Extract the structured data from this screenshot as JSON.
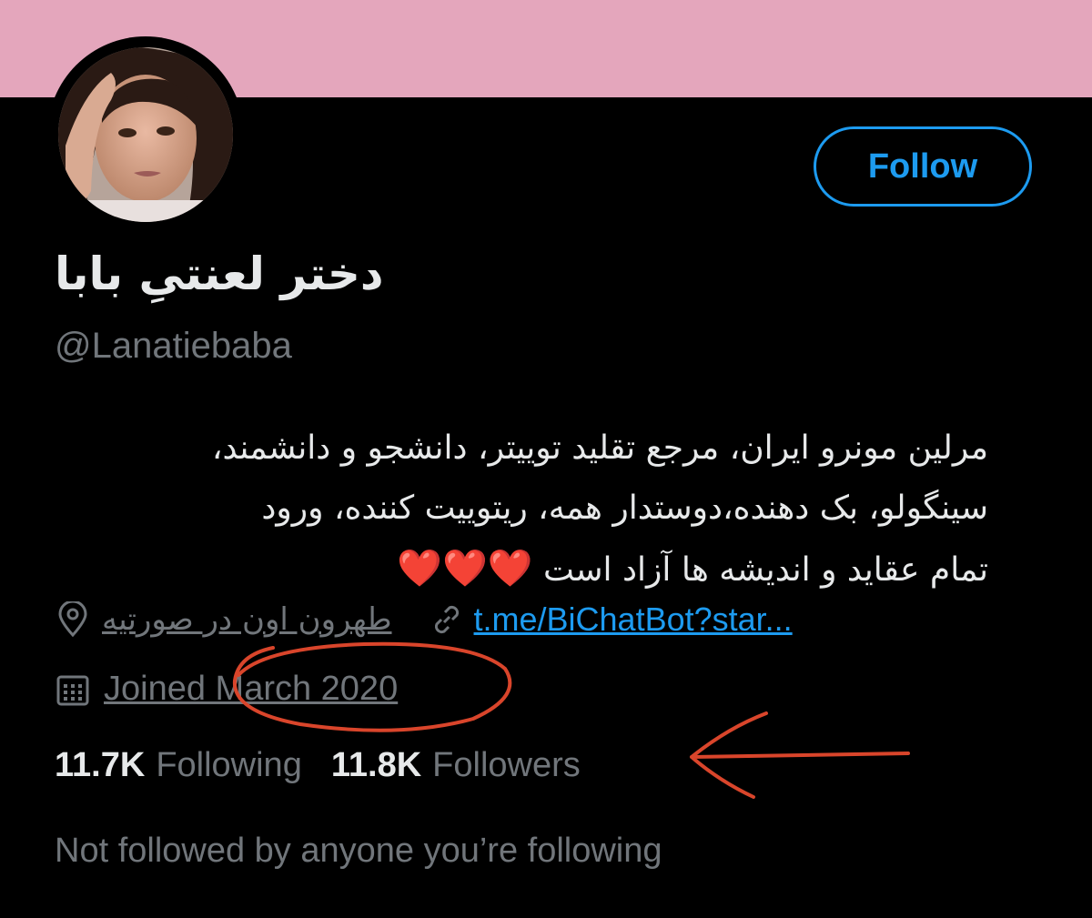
{
  "profile": {
    "display_name": "دختر لعنتیِ بابا",
    "handle": "@Lanatiebaba",
    "follow_label": "Follow",
    "bio_lines": [
      "مرلین مونرو ایران، مرجع تقلید توییتر، دانشجو و دانشمند،",
      "سینگولو، بک دهنده،دوستدار همه، ریتوییت کننده، ورود",
      "تمام عقاید و اندیشه ها آزاد است"
    ],
    "bio_hearts": "❤️❤️❤️",
    "location": "طهرون اون در صورتیه",
    "link": "t.me/BiChatBot?star...",
    "joined": "Joined March 2020",
    "following_count": "11.7K",
    "following_label": "Following",
    "followers_count": "11.8K",
    "followers_label": "Followers",
    "not_followed_text": "Not followed by anyone you’re following"
  },
  "colors": {
    "banner": "#e4a6bc",
    "accent": "#1d9bf0",
    "annotation": "#d9452b"
  },
  "icons": [
    "location-pin-icon",
    "link-icon",
    "calendar-icon"
  ]
}
